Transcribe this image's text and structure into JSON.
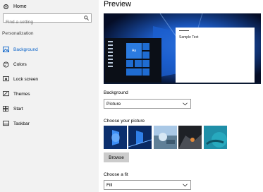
{
  "sidebar": {
    "home_label": "Home",
    "search_placeholder": "Find a setting",
    "section_label": "Personalization",
    "items": [
      {
        "label": "Background",
        "icon": "picture-icon",
        "active": true
      },
      {
        "label": "Colors",
        "icon": "palette-icon",
        "active": false
      },
      {
        "label": "Lock screen",
        "icon": "lock-screen-icon",
        "active": false
      },
      {
        "label": "Themes",
        "icon": "brush-icon",
        "active": false
      },
      {
        "label": "Start",
        "icon": "start-icon",
        "active": false
      },
      {
        "label": "Taskbar",
        "icon": "taskbar-icon",
        "active": false
      }
    ]
  },
  "main": {
    "title": "Preview",
    "preview": {
      "sample_text": "Sample Text",
      "tile_label": "Aa"
    },
    "background": {
      "label": "Background",
      "value": "Picture"
    },
    "choose_picture": {
      "label": "Choose your picture",
      "browse_label": "Browse"
    },
    "fit": {
      "label": "Choose a fit",
      "value": "Fill"
    }
  },
  "colors": {
    "accent": "#0a63c9",
    "sidebar_bg": "#f2f2f2"
  }
}
